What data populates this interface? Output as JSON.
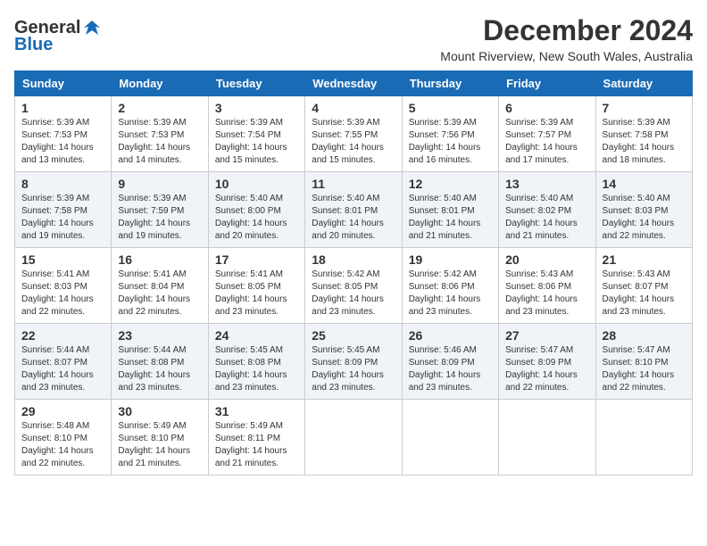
{
  "app": {
    "logo_general": "General",
    "logo_blue": "Blue"
  },
  "header": {
    "month": "December 2024",
    "location": "Mount Riverview, New South Wales, Australia"
  },
  "days_of_week": [
    "Sunday",
    "Monday",
    "Tuesday",
    "Wednesday",
    "Thursday",
    "Friday",
    "Saturday"
  ],
  "weeks": [
    [
      {
        "day": 1,
        "sunrise": "5:39 AM",
        "sunset": "7:53 PM",
        "daylight": "14 hours and 13 minutes."
      },
      {
        "day": 2,
        "sunrise": "5:39 AM",
        "sunset": "7:53 PM",
        "daylight": "14 hours and 14 minutes."
      },
      {
        "day": 3,
        "sunrise": "5:39 AM",
        "sunset": "7:54 PM",
        "daylight": "14 hours and 15 minutes."
      },
      {
        "day": 4,
        "sunrise": "5:39 AM",
        "sunset": "7:55 PM",
        "daylight": "14 hours and 15 minutes."
      },
      {
        "day": 5,
        "sunrise": "5:39 AM",
        "sunset": "7:56 PM",
        "daylight": "14 hours and 16 minutes."
      },
      {
        "day": 6,
        "sunrise": "5:39 AM",
        "sunset": "7:57 PM",
        "daylight": "14 hours and 17 minutes."
      },
      {
        "day": 7,
        "sunrise": "5:39 AM",
        "sunset": "7:58 PM",
        "daylight": "14 hours and 18 minutes."
      }
    ],
    [
      {
        "day": 8,
        "sunrise": "5:39 AM",
        "sunset": "7:58 PM",
        "daylight": "14 hours and 19 minutes."
      },
      {
        "day": 9,
        "sunrise": "5:39 AM",
        "sunset": "7:59 PM",
        "daylight": "14 hours and 19 minutes."
      },
      {
        "day": 10,
        "sunrise": "5:40 AM",
        "sunset": "8:00 PM",
        "daylight": "14 hours and 20 minutes."
      },
      {
        "day": 11,
        "sunrise": "5:40 AM",
        "sunset": "8:01 PM",
        "daylight": "14 hours and 20 minutes."
      },
      {
        "day": 12,
        "sunrise": "5:40 AM",
        "sunset": "8:01 PM",
        "daylight": "14 hours and 21 minutes."
      },
      {
        "day": 13,
        "sunrise": "5:40 AM",
        "sunset": "8:02 PM",
        "daylight": "14 hours and 21 minutes."
      },
      {
        "day": 14,
        "sunrise": "5:40 AM",
        "sunset": "8:03 PM",
        "daylight": "14 hours and 22 minutes."
      }
    ],
    [
      {
        "day": 15,
        "sunrise": "5:41 AM",
        "sunset": "8:03 PM",
        "daylight": "14 hours and 22 minutes."
      },
      {
        "day": 16,
        "sunrise": "5:41 AM",
        "sunset": "8:04 PM",
        "daylight": "14 hours and 22 minutes."
      },
      {
        "day": 17,
        "sunrise": "5:41 AM",
        "sunset": "8:05 PM",
        "daylight": "14 hours and 23 minutes."
      },
      {
        "day": 18,
        "sunrise": "5:42 AM",
        "sunset": "8:05 PM",
        "daylight": "14 hours and 23 minutes."
      },
      {
        "day": 19,
        "sunrise": "5:42 AM",
        "sunset": "8:06 PM",
        "daylight": "14 hours and 23 minutes."
      },
      {
        "day": 20,
        "sunrise": "5:43 AM",
        "sunset": "8:06 PM",
        "daylight": "14 hours and 23 minutes."
      },
      {
        "day": 21,
        "sunrise": "5:43 AM",
        "sunset": "8:07 PM",
        "daylight": "14 hours and 23 minutes."
      }
    ],
    [
      {
        "day": 22,
        "sunrise": "5:44 AM",
        "sunset": "8:07 PM",
        "daylight": "14 hours and 23 minutes."
      },
      {
        "day": 23,
        "sunrise": "5:44 AM",
        "sunset": "8:08 PM",
        "daylight": "14 hours and 23 minutes."
      },
      {
        "day": 24,
        "sunrise": "5:45 AM",
        "sunset": "8:08 PM",
        "daylight": "14 hours and 23 minutes."
      },
      {
        "day": 25,
        "sunrise": "5:45 AM",
        "sunset": "8:09 PM",
        "daylight": "14 hours and 23 minutes."
      },
      {
        "day": 26,
        "sunrise": "5:46 AM",
        "sunset": "8:09 PM",
        "daylight": "14 hours and 23 minutes."
      },
      {
        "day": 27,
        "sunrise": "5:47 AM",
        "sunset": "8:09 PM",
        "daylight": "14 hours and 22 minutes."
      },
      {
        "day": 28,
        "sunrise": "5:47 AM",
        "sunset": "8:10 PM",
        "daylight": "14 hours and 22 minutes."
      }
    ],
    [
      {
        "day": 29,
        "sunrise": "5:48 AM",
        "sunset": "8:10 PM",
        "daylight": "14 hours and 22 minutes."
      },
      {
        "day": 30,
        "sunrise": "5:49 AM",
        "sunset": "8:10 PM",
        "daylight": "14 hours and 21 minutes."
      },
      {
        "day": 31,
        "sunrise": "5:49 AM",
        "sunset": "8:11 PM",
        "daylight": "14 hours and 21 minutes."
      },
      null,
      null,
      null,
      null
    ]
  ]
}
